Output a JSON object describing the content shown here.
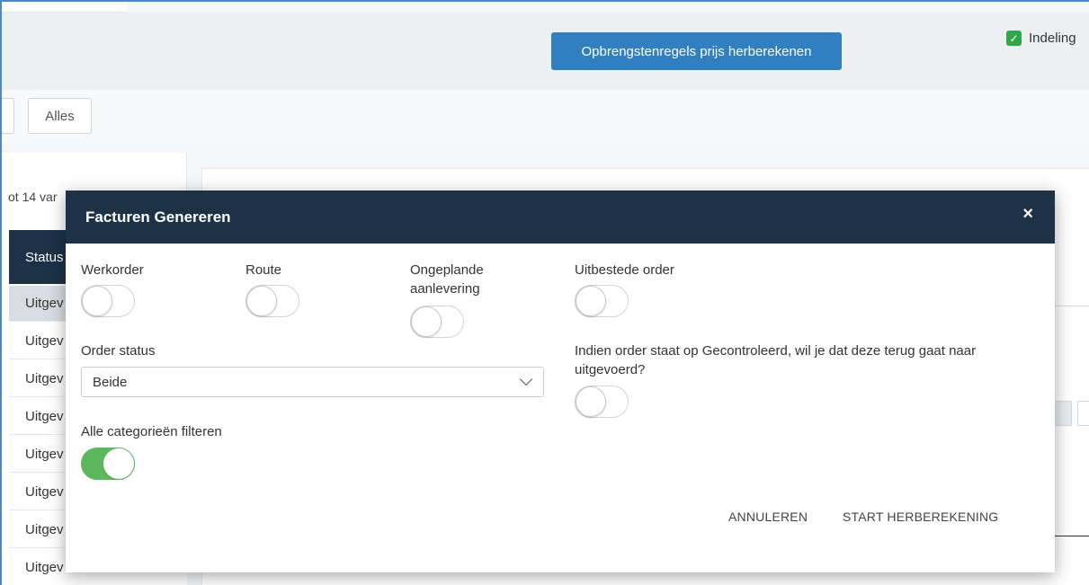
{
  "header": {
    "recalc_button": "Opbrengstenregels prijs herberekenen",
    "layout_label": "Indeling"
  },
  "filters": {
    "all_button": "Alles"
  },
  "list": {
    "range_text": "ot 14 var",
    "status_header": "Status",
    "rows": [
      "Uitgev",
      "Uitgev",
      "Uitgev",
      "Uitgev",
      "Uitgev",
      "Uitgev",
      "Uitgev",
      "Uitgev"
    ]
  },
  "modal": {
    "title": "Facturen Genereren",
    "close_glyph": "×",
    "werkorder_label": "Werkorder",
    "werkorder_on": false,
    "route_label": "Route",
    "route_on": false,
    "ongeplande_label": "Ongeplande aanlevering",
    "ongeplande_on": false,
    "uitbestede_label": "Uitbestede order",
    "uitbestede_on": false,
    "order_status_label": "Order status",
    "order_status_value": "Beide",
    "gecontroleerd_label": "Indien order staat op Gecontroleerd, wil je dat deze terug gaat naar uitgevoerd?",
    "gecontroleerd_on": false,
    "categorieen_label": "Alle categorieën filteren",
    "categorieen_on": true,
    "cancel_button": "ANNULEREN",
    "start_button": "START HERBEREKENING"
  },
  "colors": {
    "header_dark": "#1d3247",
    "primary_blue": "#2f7fc1",
    "toggle_on": "#5cb85c",
    "check_green": "#2ea84a"
  }
}
